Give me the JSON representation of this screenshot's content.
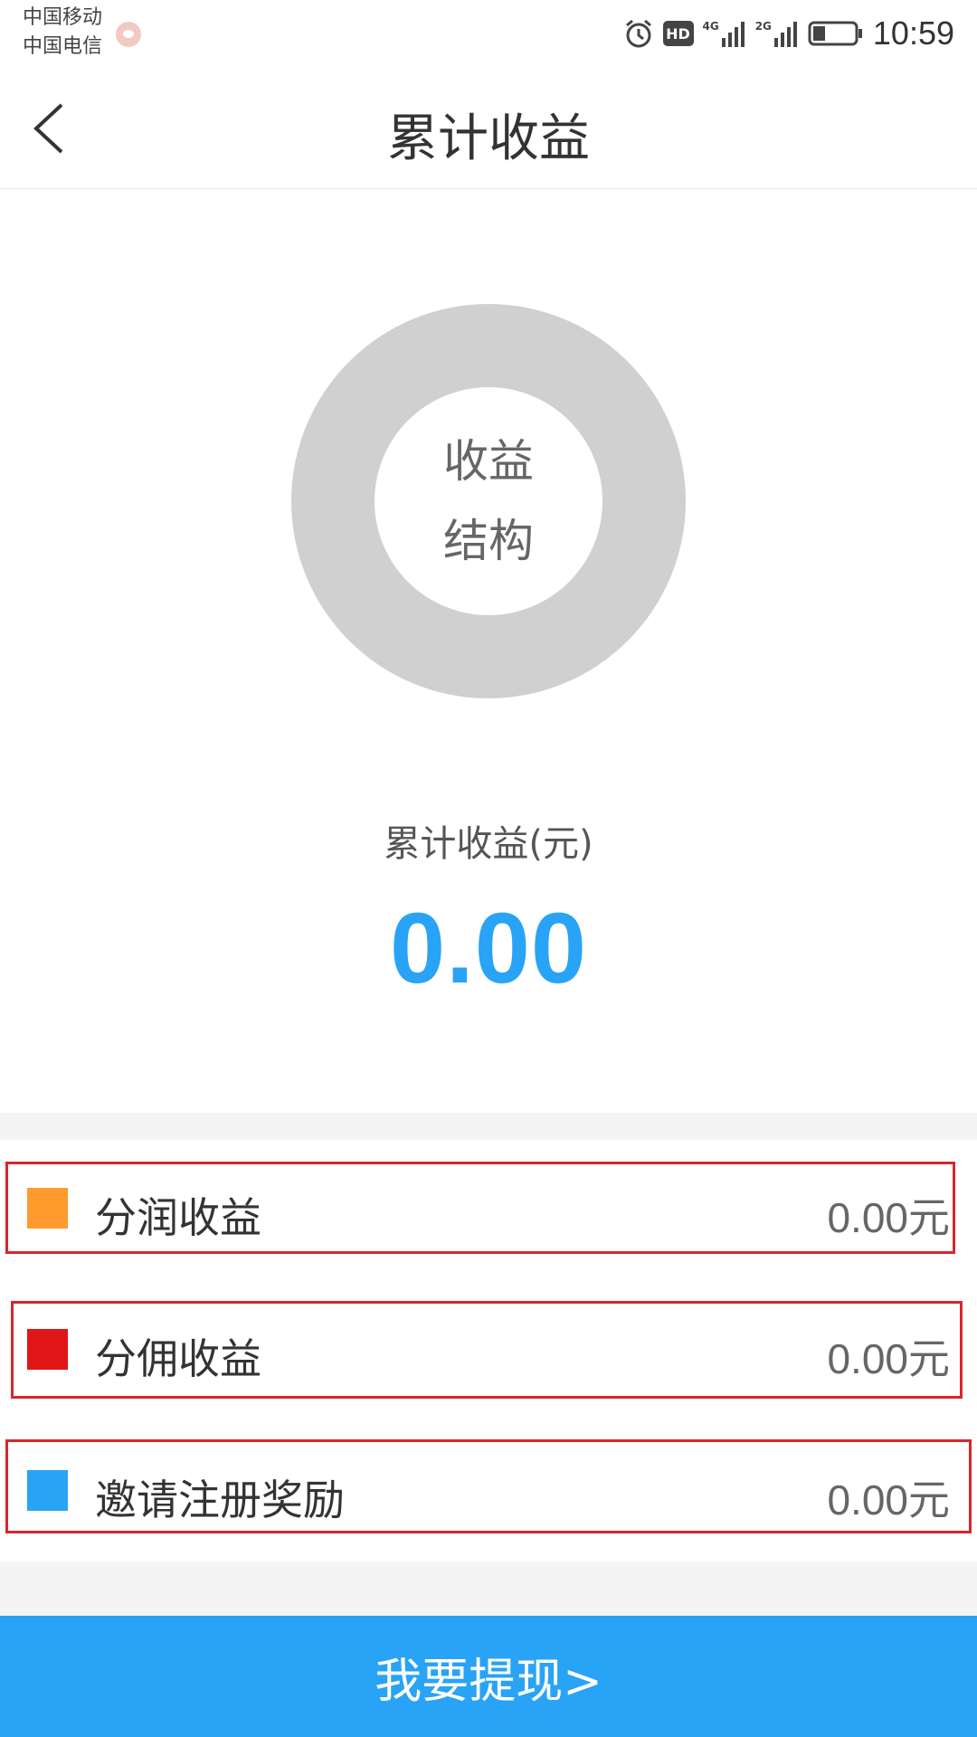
{
  "status_bar": {
    "carrier_1": "中国移动",
    "carrier_2": "中国电信",
    "network_1": "4G",
    "network_2": "2G",
    "hd_badge": "HD",
    "time": "10:59",
    "battery_level": 0.3
  },
  "header": {
    "back_icon": "chevron-left-icon",
    "title": "累计收益"
  },
  "donut": {
    "center_line_1": "收益",
    "center_line_2": "结构",
    "ring_color": "#d0d0d0"
  },
  "summary": {
    "label": "累计收益(元)",
    "value": "0.00",
    "value_color": "#29a3f5"
  },
  "income_items": [
    {
      "label": "分润收益",
      "value": "0.00",
      "unit": "元",
      "color": "#ff9a2e"
    },
    {
      "label": "分佣收益",
      "value": "0.00",
      "unit": "元",
      "color": "#e01515"
    },
    {
      "label": "邀请注册奖励",
      "value": "0.00",
      "unit": "元",
      "color": "#29a3f5"
    }
  ],
  "withdraw_button": {
    "label": "我要提现>",
    "color": "#29a3f5"
  }
}
